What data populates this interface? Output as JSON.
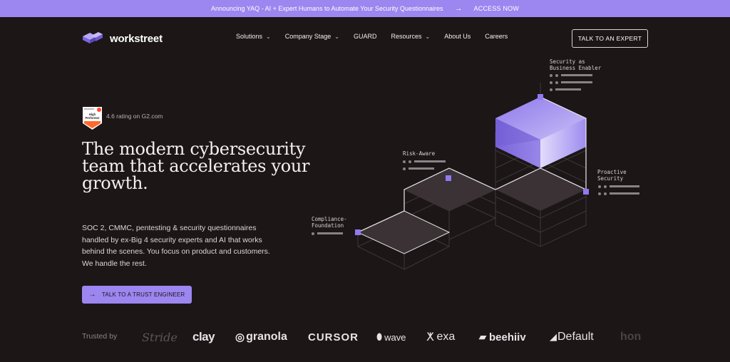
{
  "banner": {
    "text": "Announcing YAQ - AI + Expert Humans to Automate Your Security Questionnaires",
    "arrow": "→",
    "cta": "ACCESS NOW"
  },
  "header": {
    "logo_text": "workstreet",
    "nav": [
      {
        "label": "Solutions",
        "has_dropdown": true
      },
      {
        "label": "Company Stage",
        "has_dropdown": true
      },
      {
        "label": "GUARD",
        "has_dropdown": false
      },
      {
        "label": "Resources",
        "has_dropdown": true
      },
      {
        "label": "About Us",
        "has_dropdown": false
      },
      {
        "label": "Careers",
        "has_dropdown": false
      }
    ],
    "cta": "TALK TO AN EXPERT"
  },
  "hero": {
    "badge": {
      "line1": "High",
      "line2": "Performer"
    },
    "rating_text": "4.6 rating on G2.com",
    "headline": "The modern cybersecurity team that accelerates your growth.",
    "subcopy": "SOC 2, CMMC, pentesting & security questionnaires handled by ex-Big 4 security experts and AI that works behind the scenes. You focus on product and customers. We handle the rest.",
    "cta_arrow": "→",
    "cta": "TALK TO A TRUST ENGINEER"
  },
  "diagram": {
    "labels": [
      {
        "line1": "Security as",
        "line2": "Business Enabler"
      },
      {
        "line1": "Risk-Aware",
        "line2": ""
      },
      {
        "line1": "Proactive",
        "line2": "Security"
      },
      {
        "line1": "Compliance-",
        "line2": "Foundation"
      }
    ]
  },
  "trusted": {
    "label": "Trusted by",
    "brands": [
      "Stride",
      "clay",
      "granola",
      "CURSOR",
      "wave",
      "exa",
      "beehiiv",
      "Default",
      "hon"
    ]
  },
  "colors": {
    "accent": "#9c86f0",
    "background": "#1c1617"
  }
}
